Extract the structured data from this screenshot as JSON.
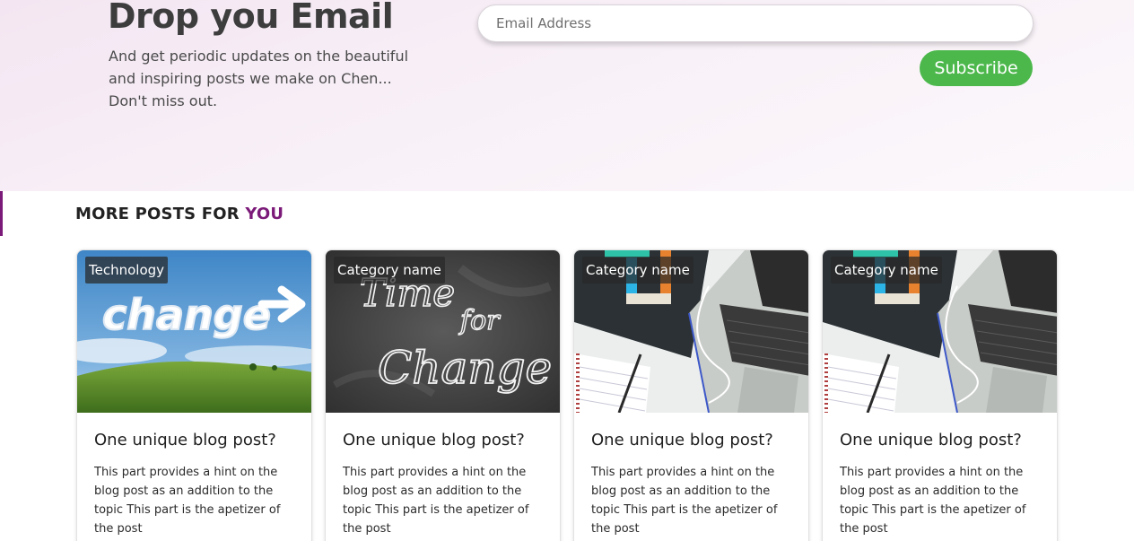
{
  "newsletter": {
    "title": "Drop you Email",
    "description": "And get periodic updates on the beautiful and inspiring posts we make on Chen... Don't miss out.",
    "email_placeholder": "Email Address",
    "subscribe_label": "Subscribe"
  },
  "more_posts": {
    "title_prefix": "MORE POSTS FOR ",
    "title_accent": "YOU",
    "accent_color": "#7b1a78"
  },
  "cards": [
    {
      "category": "Technology",
      "title": "One unique blog post?",
      "description": "This part provides a hint on the blog post as an addition to the topic This part is the apetizer of the post",
      "image": "change-sky-image"
    },
    {
      "category": "Category name",
      "title": "One unique blog post?",
      "description": "This part provides a hint on the blog post as an addition to the topic This part is the apetizer of the post",
      "image": "chalkboard-image"
    },
    {
      "category": "Category name",
      "title": "One unique blog post?",
      "description": "This part provides a hint on the blog post as an addition to the topic This part is the apetizer of the post",
      "image": "laptop-desk-image"
    },
    {
      "category": "Category name",
      "title": "One unique blog post?",
      "description": "This part provides a hint on the blog post as an addition to the topic This part is the apetizer of the post",
      "image": "laptop-desk-image"
    }
  ],
  "colors": {
    "subscribe_button": "#4cb84c",
    "accent": "#7b1a78"
  },
  "image_text": {
    "sky": "change",
    "chalk_line1": "Time",
    "chalk_line2": "for",
    "chalk_line3": "Change"
  }
}
